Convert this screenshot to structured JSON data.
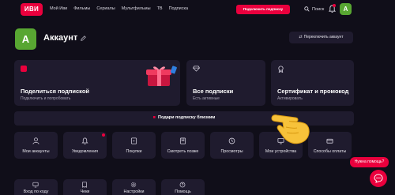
{
  "header": {
    "logo": "ИВИ",
    "nav": [
      "Мой Иви",
      "Фильмы",
      "Сериалы",
      "Мультфильмы",
      "ТВ",
      "Подписка"
    ],
    "subscribe_button": "Подключить подписку",
    "search_label": "Поиск",
    "avatar_letter": "A"
  },
  "account": {
    "avatar_letter": "A",
    "title": "Аккаунт",
    "switch_button": "Переключить аккаунт"
  },
  "cards": {
    "share": {
      "title": "Поделиться подпиской",
      "subtitle": "Подключить и попробовать"
    },
    "subscriptions": {
      "title": "Все подписки",
      "subtitle": "Есть активные"
    },
    "certificate": {
      "title": "Сертификат и промокод",
      "subtitle": "Активировать"
    }
  },
  "gift_banner": "Подари подписку близким",
  "tiles": [
    {
      "label": "Мои аккаунты",
      "icon": "user-icon"
    },
    {
      "label": "Уведомления",
      "icon": "bell-icon"
    },
    {
      "label": "Покупки",
      "icon": "purchases-icon"
    },
    {
      "label": "Смотреть позже",
      "icon": "bookmark-icon"
    },
    {
      "label": "Просмотры",
      "icon": "history-icon"
    },
    {
      "label": "Мои устройства",
      "icon": "devices-icon"
    },
    {
      "label": "Способы оплаты",
      "icon": "payment-icon"
    }
  ],
  "tiles_row2": [
    {
      "label": "Вход по коду",
      "icon": "tv-code-icon"
    },
    {
      "label": "Чеки",
      "icon": "receipt-icon"
    },
    {
      "label": "Настройки",
      "icon": "gear-icon"
    },
    {
      "label": "Помощь",
      "icon": "help-icon"
    }
  ],
  "help": {
    "bubble": "Нужна помощь?"
  },
  "colors": {
    "brand": "#ea003d",
    "avatar": "#58a632",
    "card": "#1f1b2e",
    "background": "#100e19"
  }
}
